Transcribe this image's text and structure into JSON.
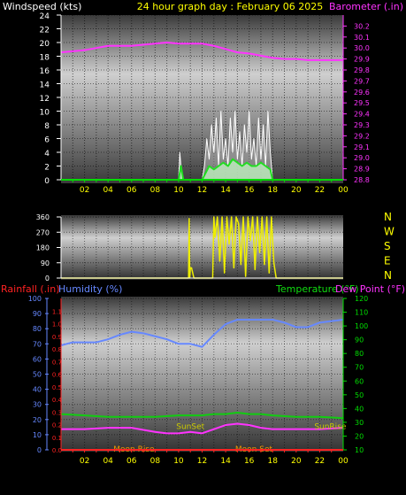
{
  "header": {
    "left_label": "Windspeed (kts)",
    "title": "24 hour graph day : February 06 2025",
    "right_label": "Barometer (.in)"
  },
  "colors": {
    "barometer": "#ff33ff",
    "wind_gust": "#ffffff",
    "wind_avg": "#22dd22",
    "wind_dir": "#eeee00",
    "humidity": "#6688ff",
    "temperature": "#11cc11",
    "dew_point": "#ff33ff",
    "rainfall": "#ff2222",
    "sun_label": "#cccc00",
    "moon_label": "#ee9900",
    "tick_right_bottom": "#00dd00",
    "tick_humidity": "#6688ff",
    "tick_rain": "#ff2222"
  },
  "chart_data": [
    {
      "type": "line",
      "name": "Wind speed and barometer",
      "xlabel": "",
      "x_ticks": [
        "02",
        "04",
        "06",
        "08",
        "10",
        "12",
        "14",
        "16",
        "18",
        "20",
        "22",
        "00"
      ],
      "y_left": {
        "label": "Windspeed (kts)",
        "range": [
          0,
          24
        ],
        "ticks": [
          0,
          2,
          4,
          6,
          8,
          10,
          12,
          14,
          16,
          18,
          20,
          22,
          24
        ]
      },
      "y_right": {
        "label": "Barometer (.in)",
        "range": [
          28.8,
          30.3
        ],
        "ticks": [
          28.8,
          28.9,
          29.0,
          29.1,
          29.2,
          29.3,
          29.4,
          29.5,
          29.6,
          29.7,
          29.8,
          29.9,
          30.0,
          30.1,
          30.2
        ]
      },
      "series": [
        {
          "name": "Barometer",
          "axis": "right",
          "color_key": "barometer",
          "x": [
            0,
            1,
            2,
            3,
            4,
            5,
            6,
            7,
            8,
            9,
            10,
            11,
            12,
            13,
            14,
            15,
            16,
            17,
            18,
            19,
            20,
            21,
            22,
            23,
            24
          ],
          "y": [
            29.96,
            29.97,
            29.98,
            30.0,
            30.02,
            30.02,
            30.02,
            30.03,
            30.04,
            30.05,
            30.04,
            30.04,
            30.04,
            30.02,
            29.99,
            29.96,
            29.95,
            29.93,
            29.91,
            29.9,
            29.9,
            29.89,
            29.89,
            29.89,
            29.89
          ]
        },
        {
          "name": "Wind gust",
          "axis": "left",
          "color_key": "wind_gust",
          "x": [
            10.0,
            10.1,
            10.2,
            10.3,
            10.4,
            10.5,
            12.0,
            12.2,
            12.4,
            12.6,
            12.8,
            13.0,
            13.2,
            13.4,
            13.6,
            13.8,
            14.0,
            14.2,
            14.4,
            14.6,
            14.8,
            15.0,
            15.2,
            15.4,
            15.6,
            15.8,
            16.0,
            16.2,
            16.4,
            16.6,
            16.8,
            17.0,
            17.2,
            17.4,
            17.6,
            17.8,
            18.0
          ],
          "y": [
            0,
            4,
            2,
            0,
            0,
            0,
            0,
            2,
            6,
            3,
            8,
            4,
            9,
            2,
            10,
            3,
            6,
            2,
            9,
            4,
            10,
            3,
            7,
            2,
            8,
            4,
            10,
            3,
            6,
            2,
            9,
            3,
            8,
            2,
            10,
            4,
            0
          ]
        },
        {
          "name": "Wind average",
          "axis": "left",
          "color_key": "wind_avg",
          "x": [
            10.0,
            10.2,
            10.4,
            12.0,
            12.3,
            12.6,
            13.0,
            13.4,
            13.8,
            14.2,
            14.6,
            15.0,
            15.4,
            15.8,
            16.2,
            16.6,
            17.0,
            17.4,
            17.8,
            18.0
          ],
          "y": [
            0,
            2,
            0,
            0,
            1,
            2,
            1.5,
            2,
            2.5,
            2,
            3,
            2.5,
            2,
            2.5,
            2,
            2,
            2.5,
            2,
            1.5,
            0
          ]
        }
      ]
    },
    {
      "type": "line",
      "name": "Wind direction",
      "y_range": [
        0,
        360
      ],
      "y_ticks": [
        0,
        90,
        180,
        270,
        360
      ],
      "right_labels": [
        "N",
        "W",
        "S",
        "E",
        "N"
      ],
      "series": [
        {
          "name": "Wind direction",
          "color_key": "wind_dir",
          "x": [
            0,
            10.85,
            10.9,
            10.95,
            11.0,
            11.1,
            11.3,
            12.9,
            13.0,
            13.1,
            13.3,
            13.5,
            13.7,
            13.9,
            14.1,
            14.3,
            14.5,
            14.7,
            14.9,
            15.1,
            15.3,
            15.5,
            15.7,
            15.9,
            16.1,
            16.3,
            16.5,
            16.7,
            16.9,
            17.1,
            17.3,
            17.5,
            17.7,
            17.9,
            18.1,
            18.3,
            24
          ],
          "y": [
            0,
            0,
            350,
            0,
            60,
            60,
            0,
            0,
            360,
            240,
            360,
            100,
            360,
            30,
            360,
            200,
            360,
            60,
            360,
            320,
            80,
            360,
            10,
            360,
            220,
            360,
            50,
            360,
            150,
            360,
            80,
            360,
            30,
            360,
            90,
            0,
            0
          ]
        }
      ]
    },
    {
      "type": "line",
      "name": "Humidity, temperature, dew point and rainfall",
      "x_ticks": [
        "02",
        "04",
        "06",
        "08",
        "10",
        "12",
        "14",
        "16",
        "18",
        "20",
        "22",
        "00"
      ],
      "y_rain": {
        "label": "Rainfall (.in)",
        "range": [
          0,
          1.2
        ],
        "ticks": [
          0,
          0.1,
          0.2,
          0.3,
          0.4,
          0.5,
          0.6,
          0.7,
          0.8,
          0.9,
          1.0,
          1.1
        ]
      },
      "y_humidity": {
        "label": "Humidity (%)",
        "range": [
          0,
          100
        ],
        "ticks": [
          0,
          10,
          20,
          30,
          40,
          50,
          60,
          70,
          80,
          90,
          100
        ]
      },
      "y_temp": {
        "label": "Temperature (°F)",
        "label2": "Dew Point (°F)",
        "range": [
          10,
          120
        ],
        "ticks": [
          10,
          20,
          30,
          40,
          50,
          60,
          70,
          80,
          90,
          100,
          110,
          120
        ]
      },
      "series": [
        {
          "name": "Humidity",
          "axis": "humidity",
          "color_key": "humidity",
          "x": [
            0,
            1,
            2,
            3,
            4,
            5,
            6,
            7,
            8,
            9,
            10,
            11,
            12,
            13,
            14,
            15,
            16,
            17,
            18,
            19,
            20,
            21,
            22,
            23,
            24
          ],
          "y": [
            69,
            71,
            71,
            71,
            73,
            76,
            78,
            77,
            75,
            73,
            70,
            70,
            68,
            76,
            83,
            86,
            86,
            86,
            86,
            84,
            81,
            81,
            84,
            85,
            86
          ]
        },
        {
          "name": "Temperature",
          "axis": "temp",
          "color_key": "temperature",
          "x": [
            0,
            2,
            4,
            6,
            8,
            10,
            12,
            13,
            14,
            15,
            16,
            17,
            18,
            20,
            22,
            24
          ],
          "y": [
            36,
            35,
            34,
            34,
            34,
            35,
            35,
            36,
            36,
            37,
            36,
            36,
            35,
            34,
            34,
            33
          ]
        },
        {
          "name": "Dew Point",
          "axis": "temp",
          "color_key": "dew_point",
          "x": [
            0,
            2,
            4,
            6,
            8,
            9,
            10,
            11,
            12,
            13,
            14,
            15,
            16,
            17,
            18,
            19,
            20,
            22,
            24
          ],
          "y": [
            25,
            25,
            26,
            26,
            23,
            22,
            22,
            23,
            22,
            25,
            28,
            29,
            28,
            26,
            25,
            25,
            25,
            25,
            26
          ]
        },
        {
          "name": "Rainfall",
          "axis": "rain",
          "color_key": "rainfall",
          "x": [
            0,
            24
          ],
          "y": [
            0,
            0
          ]
        }
      ],
      "annotations": [
        {
          "text": "SunSet",
          "x": 11.0,
          "y_temp": 27,
          "color_key": "sun_label"
        },
        {
          "text": "SunRise",
          "x": 22.9,
          "y_temp": 27,
          "color_key": "sun_label"
        },
        {
          "text": "Moon Rise",
          "x": 6.2,
          "y_temp": 10.5,
          "color_key": "moon_label"
        },
        {
          "text": "Moon Set",
          "x": 16.4,
          "y_temp": 10.5,
          "color_key": "moon_label"
        }
      ]
    }
  ],
  "labels": {
    "rain_axis": "Rainfall (.in)",
    "humidity_axis": "Humidity (%)",
    "temp_axis": "Temperature (°F)",
    "dew_axis": "Dew Point (°F)"
  }
}
